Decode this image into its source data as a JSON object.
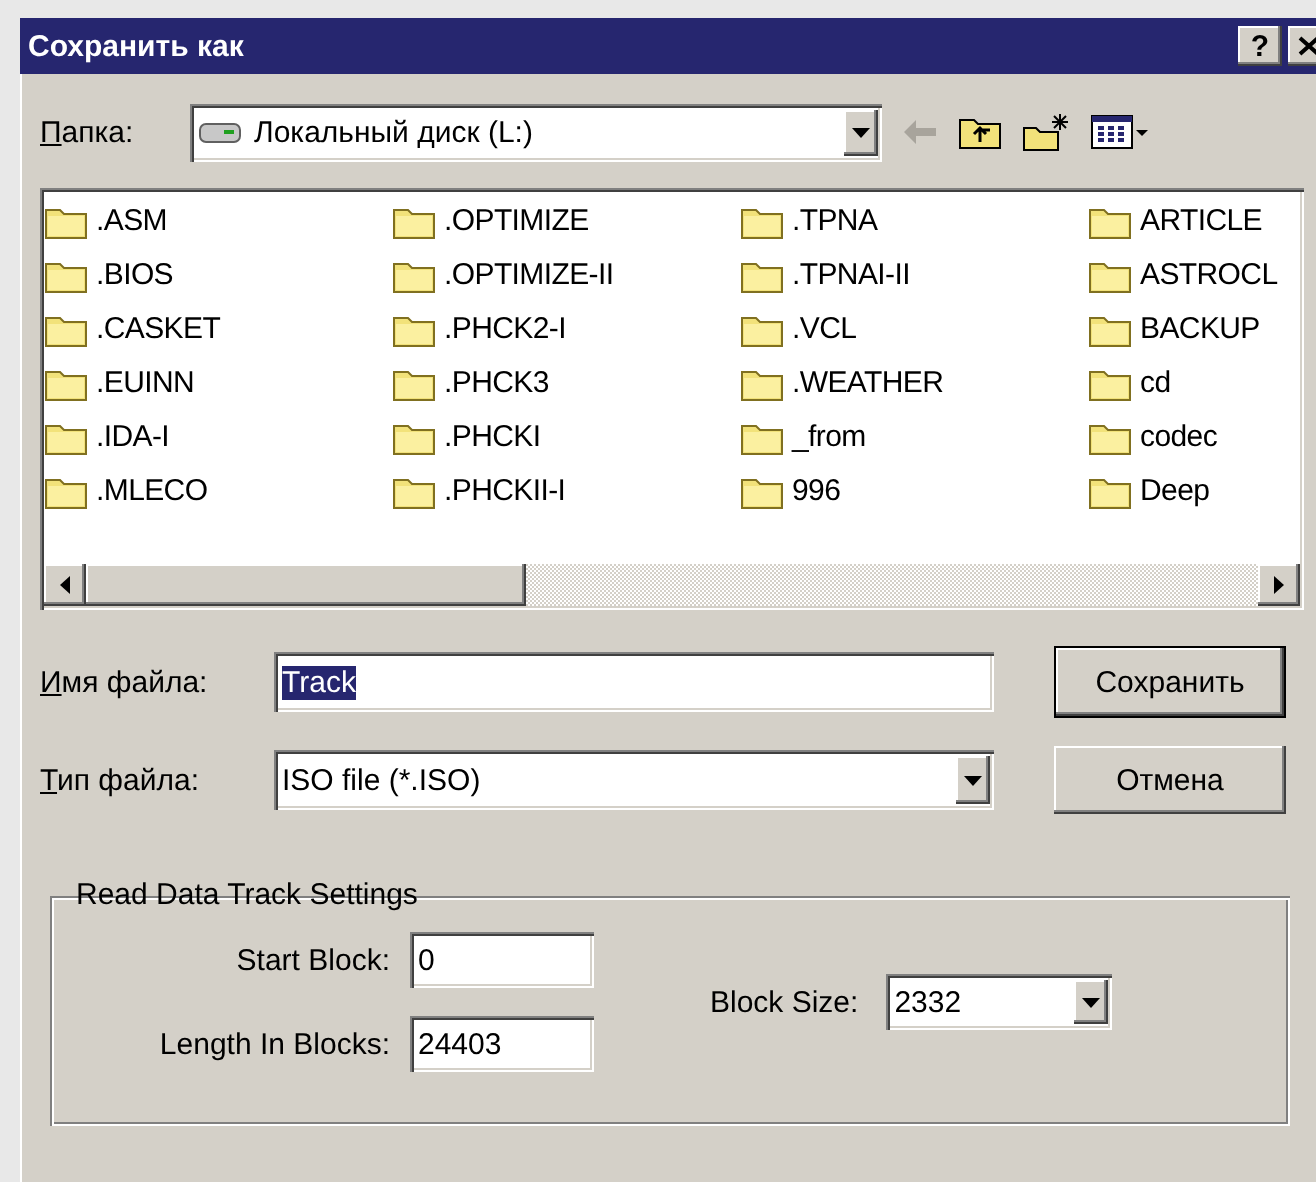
{
  "window": {
    "title": "Сохранить как",
    "help_button": "?"
  },
  "folder_bar": {
    "label": "Папка:",
    "value": "Локальный диск (L:)",
    "toolbar": [
      {
        "kind": "back",
        "disabled": true
      },
      {
        "kind": "up",
        "disabled": false
      },
      {
        "kind": "new-folder",
        "disabled": false
      },
      {
        "kind": "view-menu",
        "disabled": false
      }
    ]
  },
  "files": [
    ".ASM",
    ".BIOS",
    ".CASKET",
    ".EUINN",
    ".IDA-I",
    ".MLECO",
    ".OPTIMIZE",
    ".OPTIMIZE-II",
    ".PHCK2-I",
    ".PHCK3",
    ".PHCKI",
    ".PHCKII-I",
    ".TPNA",
    ".TPNAI-II",
    ".VCL",
    ".WEATHER",
    "_from",
    "996",
    "ARTICLE",
    "ASTROCL",
    "BACKUP",
    "cd",
    "codec",
    "Deep"
  ],
  "file_name": {
    "label": "Имя файла:",
    "value": "Track",
    "selected": true
  },
  "file_type": {
    "label": "Тип файла:",
    "value": "ISO file (*.ISO)"
  },
  "buttons": [
    {
      "label": "Сохранить",
      "default": true
    },
    {
      "label": "Отмена",
      "default": false
    }
  ],
  "settings": {
    "title": "Read Data Track Settings",
    "start_block": {
      "label": "Start Block:",
      "value": "0"
    },
    "length": {
      "label": "Length In Blocks:",
      "value": "24403"
    },
    "block_size": {
      "label": "Block Size:",
      "value": "2332"
    }
  }
}
